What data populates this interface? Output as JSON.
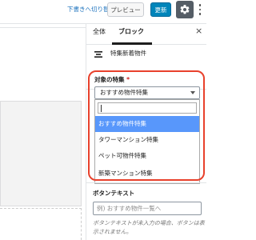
{
  "toolbar": {
    "draft_link": "下書きへ切り替え",
    "preview": "プレビュー",
    "update": "更新"
  },
  "sidebar": {
    "tabs": [
      "全体",
      "ブロック"
    ],
    "active_tab": "ブロック",
    "close_symbol": "×",
    "block_name": "特集新着物件"
  },
  "feature_field": {
    "label": "対象の特集",
    "required_mark": "*",
    "selected_value": "おすすめ物件特集",
    "search_value": "",
    "options": [
      "おすすめ物件特集",
      "タワーマンション特集",
      "ペット可物件特集",
      "新築マンション特集"
    ],
    "highlighted_option": "おすすめ物件特集"
  },
  "button_text_field": {
    "label": "ボタンテキスト",
    "placeholder": "例) おすすめ物件一覧へ",
    "help": "ボタンテキストが未入力の場合、ボタンは表示されません。"
  },
  "colors": {
    "accent": "#0085ba",
    "highlight_ring": "#e8412c",
    "selected_option": "#5897fb"
  }
}
